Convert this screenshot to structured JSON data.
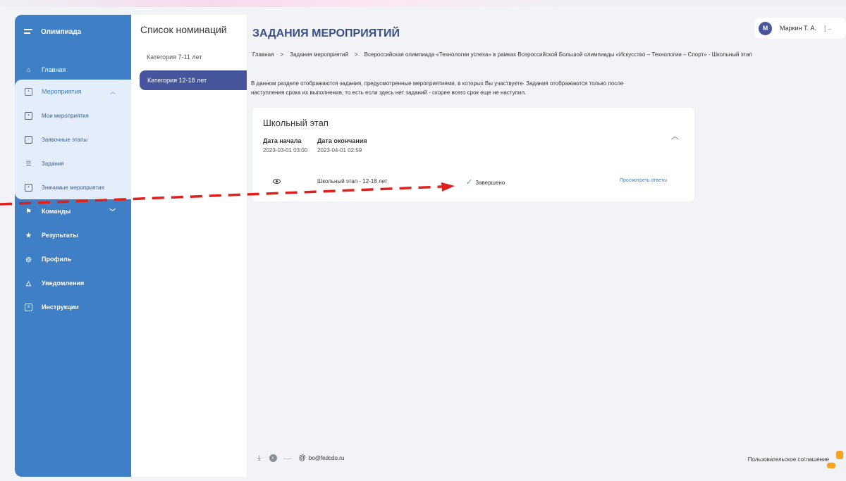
{
  "sidebar": {
    "app_title": "Олимпиада",
    "home_label": "Главная",
    "events": {
      "label": "Мероприятия",
      "items": [
        "Мои мероприятия",
        "Заявочные этапы",
        "Задания",
        "Значимые мероприятия"
      ]
    },
    "items": [
      {
        "label": "Команды",
        "icon": "team-icon",
        "has_chevron": true
      },
      {
        "label": "Результаты",
        "icon": "trophy-icon"
      },
      {
        "label": "Профиль",
        "icon": "profile-icon"
      },
      {
        "label": "Уведомления",
        "icon": "bell-icon"
      },
      {
        "label": "Инструкции",
        "icon": "document-icon"
      }
    ]
  },
  "nominations": {
    "title": "Список номинаций",
    "items": [
      "Категория 7-11 лет",
      "Категория 12-18 лет"
    ],
    "active_index": 1
  },
  "user": {
    "avatar_initial": "М",
    "name": "Маркин Т. А."
  },
  "page": {
    "title": "ЗАДАНИЯ МЕРОПРИЯТИЙ",
    "breadcrumb": [
      "Главная",
      "Задания мероприятий",
      "Всероссийская олимпиада «Технологии успеха» в рамках Всероссийской Большой олимпиады «Искусство – Технологии – Спорт» - Школьный этап"
    ],
    "description_line1": "В данном разделе отображаются задания, предусмотренные мероприятиями, в которых Вы участвуете. Задания отображаются только после",
    "description_line2": "наступления срока их выполнения, то есть если здесь нет заданий - скорее всего срок еще не наступил."
  },
  "stage_card": {
    "title": "Школьный этап",
    "start_label": "Дата начала",
    "start_value": "2023-03-01 03:00",
    "end_label": "Дата окончания",
    "end_value": "2023-04-01 02:59",
    "task": {
      "name": "Школьный этап - 12-18 лет",
      "status": "Завершено",
      "link": "Просмотреть ответы"
    }
  },
  "footer": {
    "dash_text": "⸺",
    "email": "bo@fedcdo.ru",
    "agreement": "Пользовательское соглашение"
  },
  "colors": {
    "sidebar": "#3f7fc6",
    "accent": "#46559c",
    "status_ok": "#4caf50",
    "annotation_arrow": "#e0201b"
  }
}
